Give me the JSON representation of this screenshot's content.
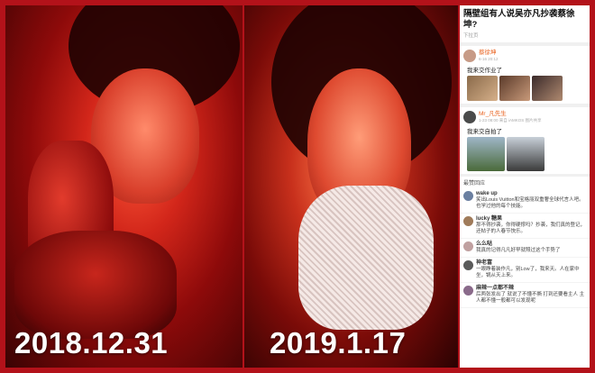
{
  "photos": {
    "left_date": "2018.12.31",
    "right_date": "2019.1.17"
  },
  "weibo": {
    "title": "隔壁组有人说吴亦凡抄袭蔡徐坤?",
    "subtitle": "下拉页",
    "post1": {
      "user": "蔡徐坤",
      "meta": "6-16 20:12",
      "text": "我来交作业了"
    },
    "post2": {
      "user": "Mr_凡先生",
      "meta": "1-23 08:00 来自 iAMKOS 图片共享",
      "text": "我来交自拍了"
    },
    "comment_header": "最赞回应",
    "comments": [
      {
        "name": "wake up",
        "text": "笑出Louis Vuitton和宝格丽双重奢全球代言人吧。也学过他的每个技能。"
      },
      {
        "name": "lucky 糖果",
        "text": "那不得抄袭，你得硬撑吗？抄袭，我们真的登记，还帖子的人春节快乐。"
      },
      {
        "name": "么么哒",
        "text": "我真的记得凡凡好早就照过这个手势了"
      },
      {
        "name": "神老富",
        "text": "一眼睁着装作凡，别Low了，我来天。人在家中坐，锅从天上来。"
      },
      {
        "name": "麻辣一点都不辣",
        "text": "后两张发出了 就说了不懂不撕 打到还要看主人 主人都不懂一般都可以发现呢"
      }
    ]
  },
  "colors": {
    "frame": "#b3121a",
    "username": "#e8601c"
  }
}
